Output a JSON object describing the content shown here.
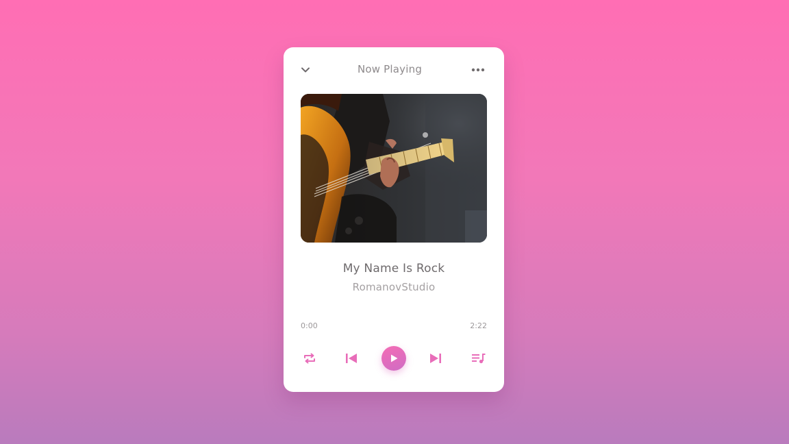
{
  "header": {
    "title": "Now Playing",
    "left_icon": "chevron-down-icon",
    "right_icon": "more-horizontal-icon"
  },
  "artwork": {
    "subject": "guitar-photo"
  },
  "track": {
    "title": "My Name Is Rock",
    "artist": "RomanovStudio"
  },
  "playback": {
    "elapsed": "0:00",
    "total": "2:22",
    "progress_fraction": 0
  },
  "controls": {
    "repeat": "repeat-icon",
    "previous": "skip-previous-icon",
    "play": "play-icon",
    "next": "skip-next-icon",
    "queue": "queue-music-icon"
  },
  "colors": {
    "accent": "#e86db9",
    "accent_gradient_start": "#f46db5",
    "accent_gradient_end": "#cf6cc4",
    "background_top": "#ff6eb4",
    "background_bottom": "#b97bbd",
    "card": "#ffffff"
  }
}
